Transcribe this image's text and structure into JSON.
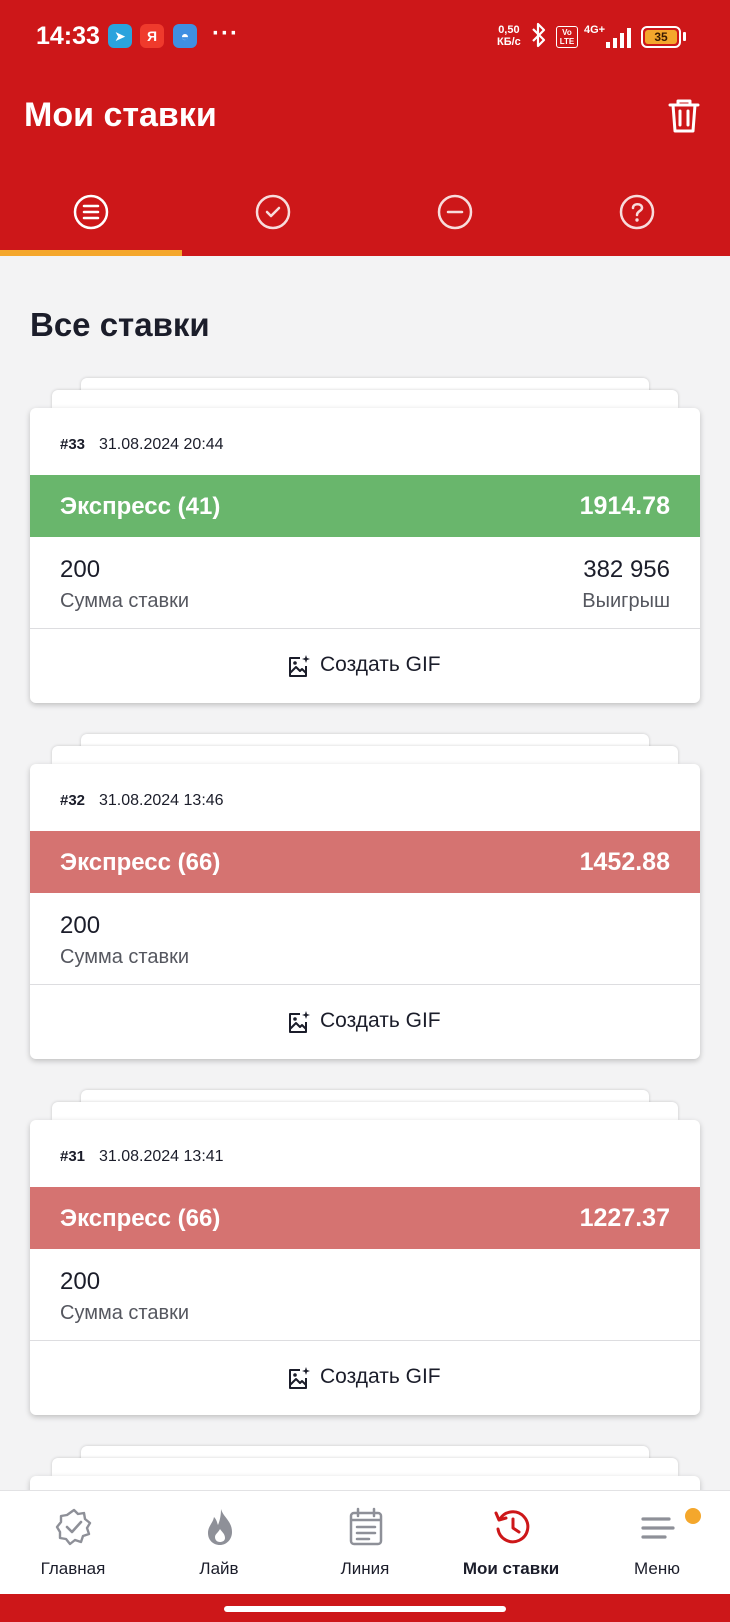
{
  "status_bar": {
    "time": "14:33",
    "app_icons": [
      {
        "name": "telegram-icon",
        "glyph": "➤",
        "color": "#2aa3dd"
      },
      {
        "name": "yandex-icon",
        "glyph": "Я",
        "color": "#ef3a2c"
      },
      {
        "name": "browser-icon",
        "glyph": "◓",
        "color": "#3f8fe2"
      }
    ],
    "more": "···",
    "net_speed_value": "0,50",
    "net_speed_unit": "КБ/с",
    "volte_top": "Vo",
    "volte_bottom": "LTE",
    "network": "4G+",
    "battery": "35"
  },
  "header": {
    "title": "Мои ставки",
    "trash_icon": "trash-icon"
  },
  "tabs": [
    {
      "name": "all",
      "icon": "list-circle-icon",
      "active": true
    },
    {
      "name": "won",
      "icon": "check-circle-icon",
      "active": false
    },
    {
      "name": "lost",
      "icon": "minus-circle-icon",
      "active": false
    },
    {
      "name": "pending",
      "icon": "question-circle-icon",
      "active": false
    }
  ],
  "section_title": "Все ставки",
  "bets": [
    {
      "id": "#33",
      "date": "31.08.2024 20:44",
      "type": "Экспресс (41)",
      "odds": "1914.78",
      "status": "win",
      "stake": "200",
      "stake_label": "Сумма ставки",
      "payout": "382 956",
      "payout_label": "Выигрыш",
      "gif_label": "Создать GIF"
    },
    {
      "id": "#32",
      "date": "31.08.2024 13:46",
      "type": "Экспресс (66)",
      "odds": "1452.88",
      "status": "lose",
      "stake": "200",
      "stake_label": "Сумма ставки",
      "gif_label": "Создать GIF"
    },
    {
      "id": "#31",
      "date": "31.08.2024 13:41",
      "type": "Экспресс (66)",
      "odds": "1227.37",
      "status": "lose",
      "stake": "200",
      "stake_label": "Сумма ставки",
      "gif_label": "Создать GIF"
    }
  ],
  "bottom_nav": [
    {
      "label": "Главная",
      "icon": "home-badge-icon",
      "active": false
    },
    {
      "label": "Лайв",
      "icon": "flame-icon",
      "active": false
    },
    {
      "label": "Линия",
      "icon": "calendar-icon",
      "active": false
    },
    {
      "label": "Мои ставки",
      "icon": "history-icon",
      "active": true
    },
    {
      "label": "Меню",
      "icon": "menu-icon",
      "active": false,
      "badge": true
    }
  ],
  "colors": {
    "brand_red": "#cd1719",
    "accent_orange": "#f4a72c",
    "win_green": "#69b66c",
    "lose_red": "#d57371"
  }
}
